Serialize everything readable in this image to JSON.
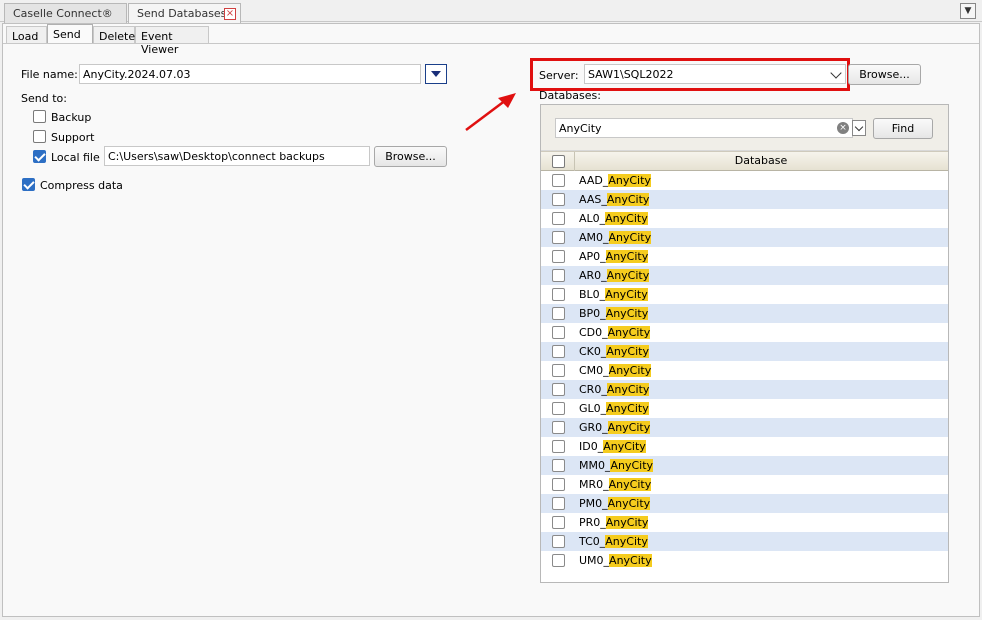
{
  "doc_tabs": [
    {
      "label": "Caselle Connect®"
    },
    {
      "label": "Send Databases"
    }
  ],
  "sub_tabs": [
    "Load",
    "Send",
    "Delete",
    "Event Viewer"
  ],
  "left": {
    "file_name_label": "File name:",
    "file_name_value": "AnyCity.2024.07.03",
    "send_to_label": "Send to:",
    "backup_label": "Backup",
    "backup_checked": false,
    "support_label": "Support",
    "support_checked": false,
    "local_file_label": "Local file",
    "local_file_checked": true,
    "local_file_path": "C:\\Users\\saw\\Desktop\\connect backups",
    "browse_label": "Browse...",
    "compress_label": "Compress data",
    "compress_checked": true
  },
  "right": {
    "server_label": "Server:",
    "server_value": "SAW1\\SQL2022",
    "browse_label": "Browse...",
    "databases_label": "Databases:",
    "search_value": "AnyCity",
    "find_label": "Find",
    "column_header": "Database",
    "databases": [
      {
        "prefix": "AAD_",
        "match": "AnyCity"
      },
      {
        "prefix": "AAS_",
        "match": "AnyCity"
      },
      {
        "prefix": "AL0_",
        "match": "AnyCity"
      },
      {
        "prefix": "AM0_",
        "match": "AnyCity"
      },
      {
        "prefix": "AP0_",
        "match": "AnyCity"
      },
      {
        "prefix": "AR0_",
        "match": "AnyCity"
      },
      {
        "prefix": "BL0_",
        "match": "AnyCity"
      },
      {
        "prefix": "BP0_",
        "match": "AnyCity"
      },
      {
        "prefix": "CD0_",
        "match": "AnyCity"
      },
      {
        "prefix": "CK0_",
        "match": "AnyCity"
      },
      {
        "prefix": "CM0_",
        "match": "AnyCity"
      },
      {
        "prefix": "CR0_",
        "match": "AnyCity"
      },
      {
        "prefix": "GL0_",
        "match": "AnyCity"
      },
      {
        "prefix": "GR0_",
        "match": "AnyCity"
      },
      {
        "prefix": "ID0_",
        "match": "AnyCity"
      },
      {
        "prefix": "MM0_",
        "match": "AnyCity"
      },
      {
        "prefix": "MR0_",
        "match": "AnyCity"
      },
      {
        "prefix": "PM0_",
        "match": "AnyCity"
      },
      {
        "prefix": "PR0_",
        "match": "AnyCity"
      },
      {
        "prefix": "TC0_",
        "match": "AnyCity"
      },
      {
        "prefix": "UM0_",
        "match": "AnyCity"
      }
    ]
  },
  "colors": {
    "highlight_box": "#e01010",
    "annotation_arrow": "#e01010",
    "match_highlight": "#f5cc1e",
    "alt_row": "#dce6f5",
    "checkbox_checked": "#2d6fc4"
  },
  "icons": {
    "doc_tab_close": "close-icon",
    "tab_menu": "chevron-down-icon",
    "search_clear": "clear-icon"
  }
}
